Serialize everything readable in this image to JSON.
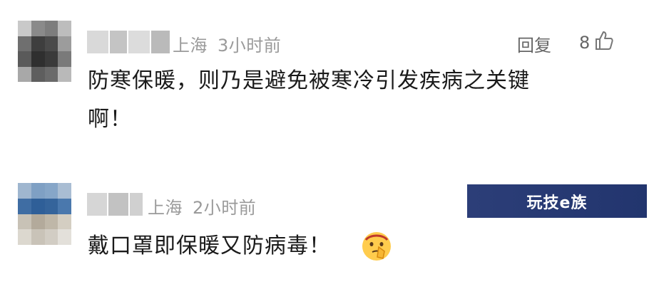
{
  "comments": [
    {
      "location": "上海",
      "time": "3小时前",
      "text_line1": "防寒保暖，则乃是避免被寒冷引发疾病之关键",
      "text_line2": "啊！",
      "reply_label": "回复",
      "like_count": "8",
      "icons": {
        "like": "thumbs-up-icon"
      }
    },
    {
      "location": "上海",
      "time": "2小时前",
      "text": "戴口罩即保暖又防病毒！",
      "emoji": "shushing-face-emoji"
    }
  ],
  "watermark": {
    "text": "玩技e族"
  },
  "colors": {
    "meta": "#9a9a9a",
    "text": "#1a1a1a",
    "watermark_bg": "#2c3e78"
  }
}
